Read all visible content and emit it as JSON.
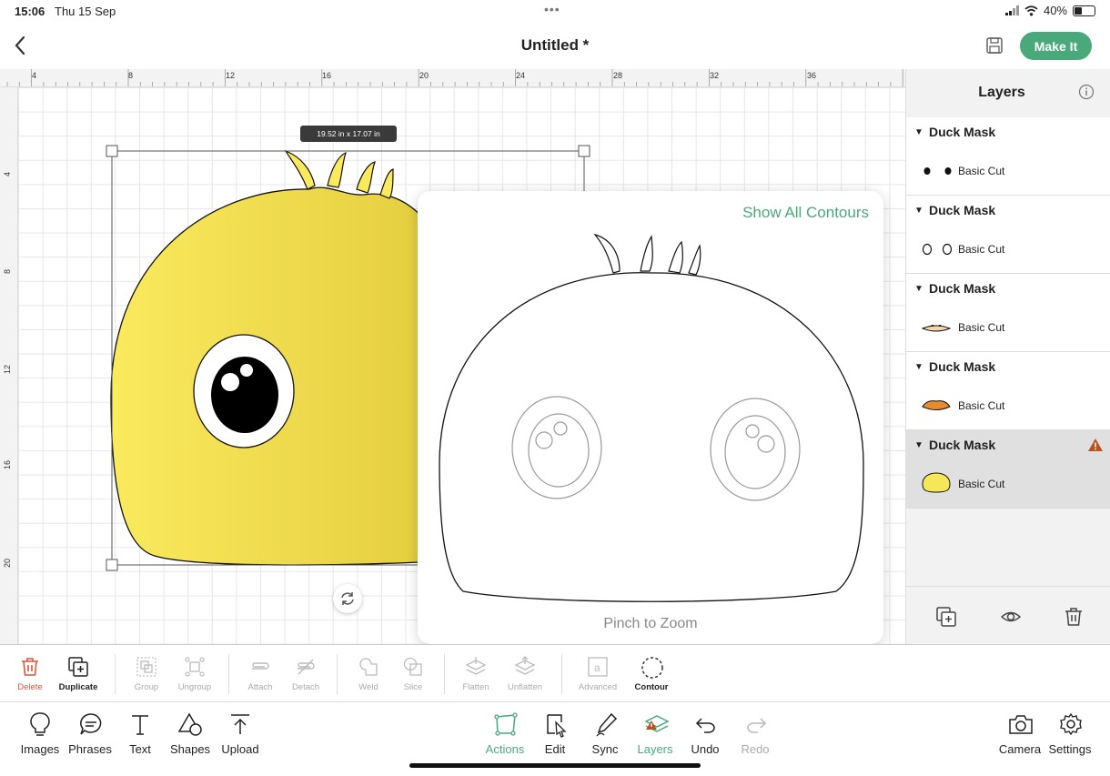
{
  "status_bar": {
    "time": "15:06",
    "date": "Thu 15 Sep",
    "battery": "40%",
    "battery_level": 0.4
  },
  "header": {
    "title": "Untitled *",
    "make_it_label": "Make It"
  },
  "ruler": {
    "top_labels": [
      "4",
      "8",
      "12",
      "16",
      "20",
      "24",
      "28",
      "32",
      "36"
    ],
    "left_labels": [
      "4",
      "8",
      "12",
      "16",
      "20"
    ]
  },
  "canvas": {
    "size_tooltip": "19.52 in x 17.07 in"
  },
  "contour_popup": {
    "show_all": "Show All Contours",
    "hint": "Pinch to Zoom"
  },
  "layers": {
    "title": "Layers",
    "groups": [
      {
        "name": "Duck Mask",
        "layer": "Basic Cut",
        "thumb": "pupils"
      },
      {
        "name": "Duck Mask",
        "layer": "Basic Cut",
        "thumb": "eye-rings"
      },
      {
        "name": "Duck Mask",
        "layer": "Basic Cut",
        "thumb": "beak-light"
      },
      {
        "name": "Duck Mask",
        "layer": "Basic Cut",
        "thumb": "beak-orange"
      },
      {
        "name": "Duck Mask",
        "layer": "Basic Cut",
        "thumb": "head-yellow",
        "selected": true,
        "warning": true
      }
    ]
  },
  "action_toolbar": {
    "delete": "Delete",
    "duplicate": "Duplicate",
    "group": "Group",
    "ungroup": "Ungroup",
    "attach": "Attach",
    "detach": "Detach",
    "weld": "Weld",
    "slice": "Slice",
    "flatten": "Flatten",
    "unflatten": "Unflatten",
    "advanced": "Advanced",
    "contour": "Contour"
  },
  "bottom_toolbar": {
    "images": "Images",
    "phrases": "Phrases",
    "text": "Text",
    "shapes": "Shapes",
    "upload": "Upload",
    "actions": "Actions",
    "edit": "Edit",
    "sync": "Sync",
    "layers": "Layers",
    "undo": "Undo",
    "redo": "Redo",
    "camera": "Camera",
    "settings": "Settings"
  },
  "colors": {
    "accent": "#4aa97b",
    "duck_yellow": "#f5e65a",
    "delete_red": "#e0553a",
    "warning": "#b5541c"
  }
}
